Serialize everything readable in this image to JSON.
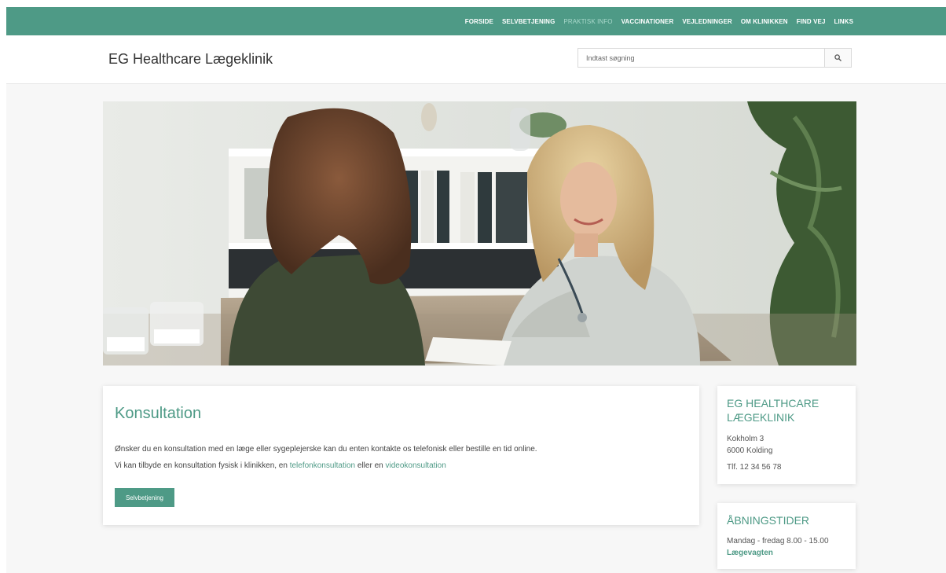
{
  "nav": {
    "items": [
      {
        "label": "FORSIDE",
        "active": false
      },
      {
        "label": "SELVBETJENING",
        "active": false
      },
      {
        "label": "PRAKTISK INFO",
        "active": true
      },
      {
        "label": "VACCINATIONER",
        "active": false
      },
      {
        "label": "VEJLEDNINGER",
        "active": false
      },
      {
        "label": "OM KLINIKKEN",
        "active": false
      },
      {
        "label": "FIND VEJ",
        "active": false
      },
      {
        "label": "LINKS",
        "active": false
      }
    ]
  },
  "header": {
    "site_title": "EG Healthcare Lægeklinik",
    "search_placeholder": "Indtast søgning",
    "search_icon": "search-icon"
  },
  "colors": {
    "brand": "#4e9a86",
    "nav_active": "#a9d8cb"
  },
  "main": {
    "title": "Konsultation",
    "line1": "Ønsker du en konsultation med en læge eller sygeplejerske kan du enten kontakte os telefonisk eller bestille en tid online.",
    "line2_prefix": "Vi kan tilbyde en konsultation fysisk i klinikken, en ",
    "link_phone": "telefonkonsultation",
    "line2_middle": " eller en ",
    "link_video": "videokonsultation",
    "button_label": "Selvbetjening"
  },
  "clinic": {
    "title": "EG HEALTHCARE LÆGEKLINIK",
    "address1": "Kokholm 3",
    "address2": "6000 Kolding",
    "phone": "Tlf. 12 34 56 78"
  },
  "hours": {
    "title": "ÅBNINGSTIDER",
    "weekdays": "Mandag - fredag 8.00 - 15.00",
    "emergency_link": "Lægevagten"
  }
}
